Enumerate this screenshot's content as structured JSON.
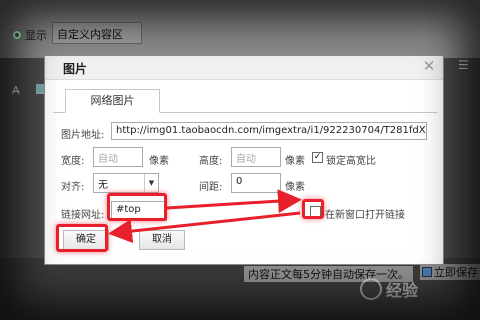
{
  "background": {
    "show_label": "显示",
    "custom_area_value": "自定义内容区",
    "autosave_text": "内容正文每5分钟自动保存一次。",
    "publish_label": "立即保存",
    "watermark_text": "经验"
  },
  "dialog": {
    "title": "图片",
    "tab_label": "网络图片",
    "image_url_label": "图片地址:",
    "image_url_value": "http://img01.taobaocdn.com/imgextra/i1/922230704/T281fdXRXXXXX",
    "width_label": "宽度:",
    "width_placeholder": "自动",
    "width_unit": "像素",
    "height_label": "高度:",
    "height_placeholder": "自动",
    "height_unit": "像素",
    "lock_ratio_label": "锁定高宽比",
    "lock_ratio_checked": true,
    "align_label": "对齐:",
    "align_value": "无",
    "spacing_label": "间距:",
    "spacing_value": "0",
    "spacing_unit": "像素",
    "link_label": "链接网址:",
    "link_value": "#top",
    "new_window_label": "在新窗口打开链接",
    "new_window_checked": false,
    "ok_label": "确定",
    "cancel_label": "取消"
  },
  "colors": {
    "annotation_red": "#e8202b",
    "dialog_border": "#8c8c8c"
  }
}
